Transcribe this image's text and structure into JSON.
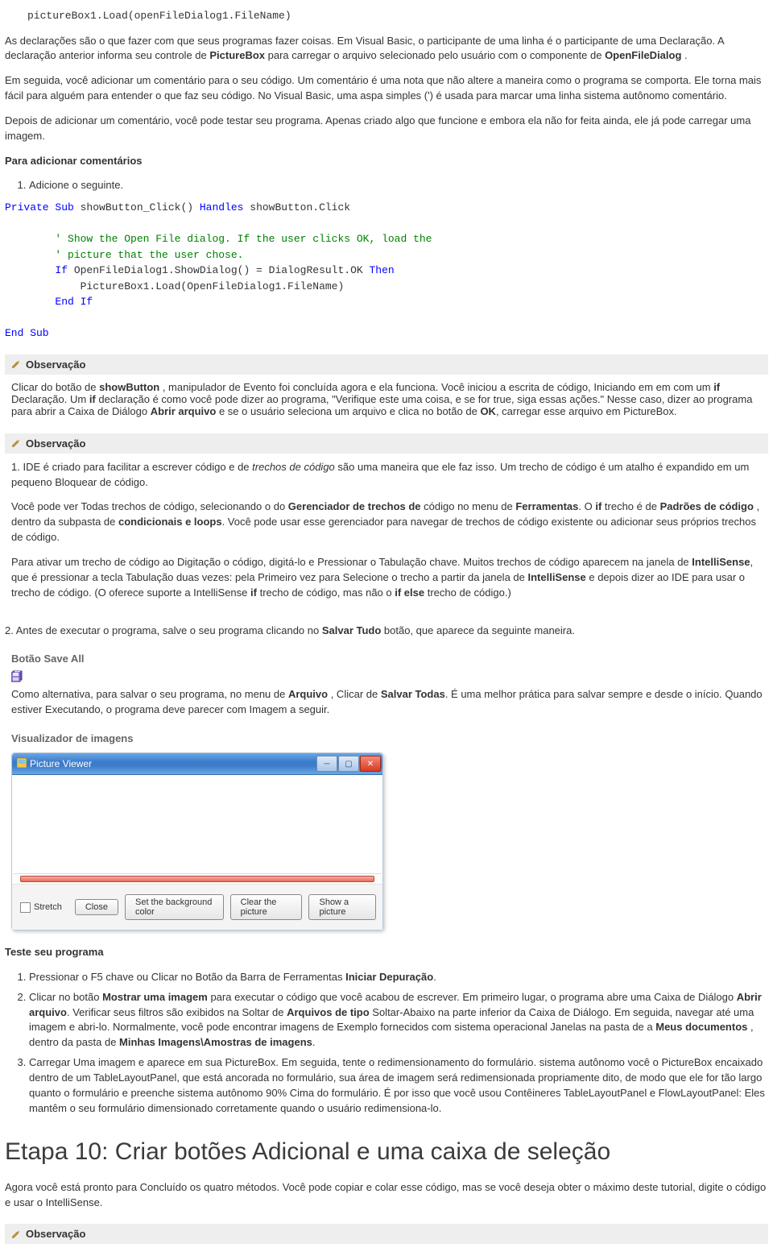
{
  "code1": "pictureBox1.Load(openFileDialog1.FileName)",
  "p1_a": "As declarações são o que fazer com que seus programas fazer coisas. Em Visual Basic, o participante de uma linha é o participante de uma Declaração. A declaração anterior informa seu controle de ",
  "p1_b1": "PictureBox",
  "p1_c": " para carregar o arquivo selecionado pelo usuário com o componente de ",
  "p1_b2": "OpenFileDialog",
  "p1_d": " .",
  "p2": "Em seguida, você adicionar um comentário para o seu código. Um comentário é uma nota que não altere a maneira como o programa se comporta. Ele torna mais fácil para alguém para entender o que faz seu código.  No Visual Basic, uma aspa simples (') é usada para marcar uma linha sistema autônomo comentário.",
  "p3": "Depois de adicionar um comentário, você pode testar seu programa. Apenas criado algo que funcione e embora ela não for feita ainda, ele já pode carregar uma imagem.",
  "h_addcomments": "Para adicionar comentários",
  "li_add": "Adicione o seguinte.",
  "code2": {
    "l1a": "Private",
    "l1b": "Sub",
    "l1c": " showButton_Click() ",
    "l1d": "Handles",
    "l1e": " showButton.Click",
    "c1": "        ' Show the Open File dialog. If the user clicks OK, load the",
    "c2": "        ' picture that the user chose.",
    "l3a": "        If",
    "l3b": " OpenFileDialog1.ShowDialog() = DialogResult.OK ",
    "l3c": "Then",
    "l4": "            PictureBox1.Load(OpenFileDialog1.FileName)",
    "l5a": "        End",
    "l5b": " If",
    "l6a": "End",
    "l6b": " Sub"
  },
  "obs_label": "Observação",
  "obs1_a": "Clicar do botão de ",
  "obs1_b1": "showButton",
  "obs1_c": " , manipulador de Evento foi concluída agora e ela funciona. Você iniciou a escrita de código, Iniciando em em com um ",
  "obs1_b2": "if",
  "obs1_d": " Declaração. Um ",
  "obs1_b3": "if",
  "obs1_e": " declaração é como você pode dizer ao programa, \"Verifique este uma coisa, e se for true, siga essas ações.\" Nesse caso, dizer ao programa para abrir a Caixa de Diálogo ",
  "obs1_b4": "Abrir arquivo",
  "obs1_f": " e se o usuário seleciona um arquivo e clica no botão de ",
  "obs1_b5": "OK",
  "obs1_g": ", carregar esse arquivo em PictureBox.",
  "obs2_p1a": "1. IDE é criado para facilitar a escrever código e de ",
  "obs2_p1i": "trechos de código",
  "obs2_p1b": " são uma maneira que ele faz isso. Um trecho de código é um atalho é expandido em um pequeno Bloquear de código.",
  "obs2_p2a": "Você pode ver Todas trechos de código, selecionando o do ",
  "obs2_p2b1": "Gerenciador de trechos de",
  "obs2_p2b": " código no menu de ",
  "obs2_p2b2": "Ferramentas",
  "obs2_p2c": ". O ",
  "obs2_p2b3": "if",
  "obs2_p2d": " trecho é de ",
  "obs2_p2b4": "Padrões de código",
  "obs2_p2e": " , dentro da subpasta de ",
  "obs2_p2b5": "condicionais e loops",
  "obs2_p2f": ". Você pode usar esse gerenciador para navegar de trechos de código existente ou adicionar seus próprios trechos de código.",
  "obs2_p3a": "Para ativar um trecho de código ao Digitação o código, digitá-lo e Pressionar o Tabulação chave. Muitos trechos de código aparecem na janela de ",
  "obs2_p3b1": "IntelliSense",
  "obs2_p3b": ", que é pressionar a tecla Tabulação duas vezes: pela Primeiro vez para Selecione o trecho a partir da janela de ",
  "obs2_p3b2": "IntelliSense",
  "obs2_p3c": " e depois dizer ao IDE para usar o trecho de código. (O oferece suporte a IntelliSense ",
  "obs2_p3b3": "if",
  "obs2_p3d": " trecho de código, mas não o ",
  "obs2_p3b4": "if else",
  "obs2_p3e": " trecho de código.)",
  "step2a": "2. Antes de executar o programa, salve o seu programa clicando no ",
  "step2b": "Salvar Tudo",
  "step2c": " botão, que aparece da seguinte maneira.",
  "h_saveall": "Botão Save All",
  "p_savealt_a": "Como alternativa, para salvar o seu programa, no menu de ",
  "p_savealt_b1": "Arquivo",
  "p_savealt_b": " , Clicar de ",
  "p_savealt_b2": "Salvar Todas",
  "p_savealt_c": ". É uma melhor prática para salvar sempre e desde o início. Quando estiver Executando, o programa deve parecer com Imagem a seguir.",
  "h_viewer": "Visualizador de imagens",
  "pv": {
    "title": "Picture Viewer",
    "stretch": "Stretch",
    "close": "Close",
    "setbg": "Set the background color",
    "clear": "Clear the picture",
    "show": "Show a picture"
  },
  "h_test": "Teste seu programa",
  "test_li1a": "Pressionar o F5 chave ou Clicar no Botão da Barra de Ferramentas ",
  "test_li1b": "Iniciar Depuração",
  "test_li1c": ".",
  "test_li2a": "Clicar no botão ",
  "test_li2b1": "Mostrar uma imagem",
  "test_li2b": " para executar o código que você acabou de escrever. Em primeiro lugar, o programa abre uma Caixa de Diálogo ",
  "test_li2b2": "Abrir arquivo",
  "test_li2c": ". Verificar seus filtros são exibidos na Soltar de ",
  "test_li2b3": "Arquivos de tipo",
  "test_li2d": " Soltar-Abaixo na parte inferior da Caixa de Diálogo. Em seguida, navegar até uma imagem e abri-lo. Normalmente, você pode encontrar imagens de Exemplo fornecidos com sistema operacional Janelas na pasta de a ",
  "test_li2b4": "Meus documentos",
  "test_li2e": " , dentro da pasta de ",
  "test_li2b5": "Minhas Imagens\\Amostras de imagens",
  "test_li2f": ".",
  "test_li3": "Carregar Uma imagem e aparece em sua PictureBox. Em seguida, tente o redimensionamento do formulário. sistema autônomo você o PictureBox encaixado dentro de um TableLayoutPanel, que está ancorada no formulário, sua área de imagem será redimensionada propriamente dito, de modo que ele for tão largo quanto o formulário e preenche sistema autônomo 90% Cima do formulário. É por isso que você usou Contêineres TableLayoutPanel e FlowLayoutPanel: Eles mantêm o seu formulário dimensionado corretamente quando o usuário redimensiona-lo.",
  "h_step10": "Etapa 10: Criar botões Adicional e uma caixa de seleção",
  "p_step10": "Agora você está pronto para Concluído os quatro métodos. Você pode copiar e colar esse código, mas se você deseja obter o máximo deste tutorial, digite o código e usar o IntelliSense."
}
